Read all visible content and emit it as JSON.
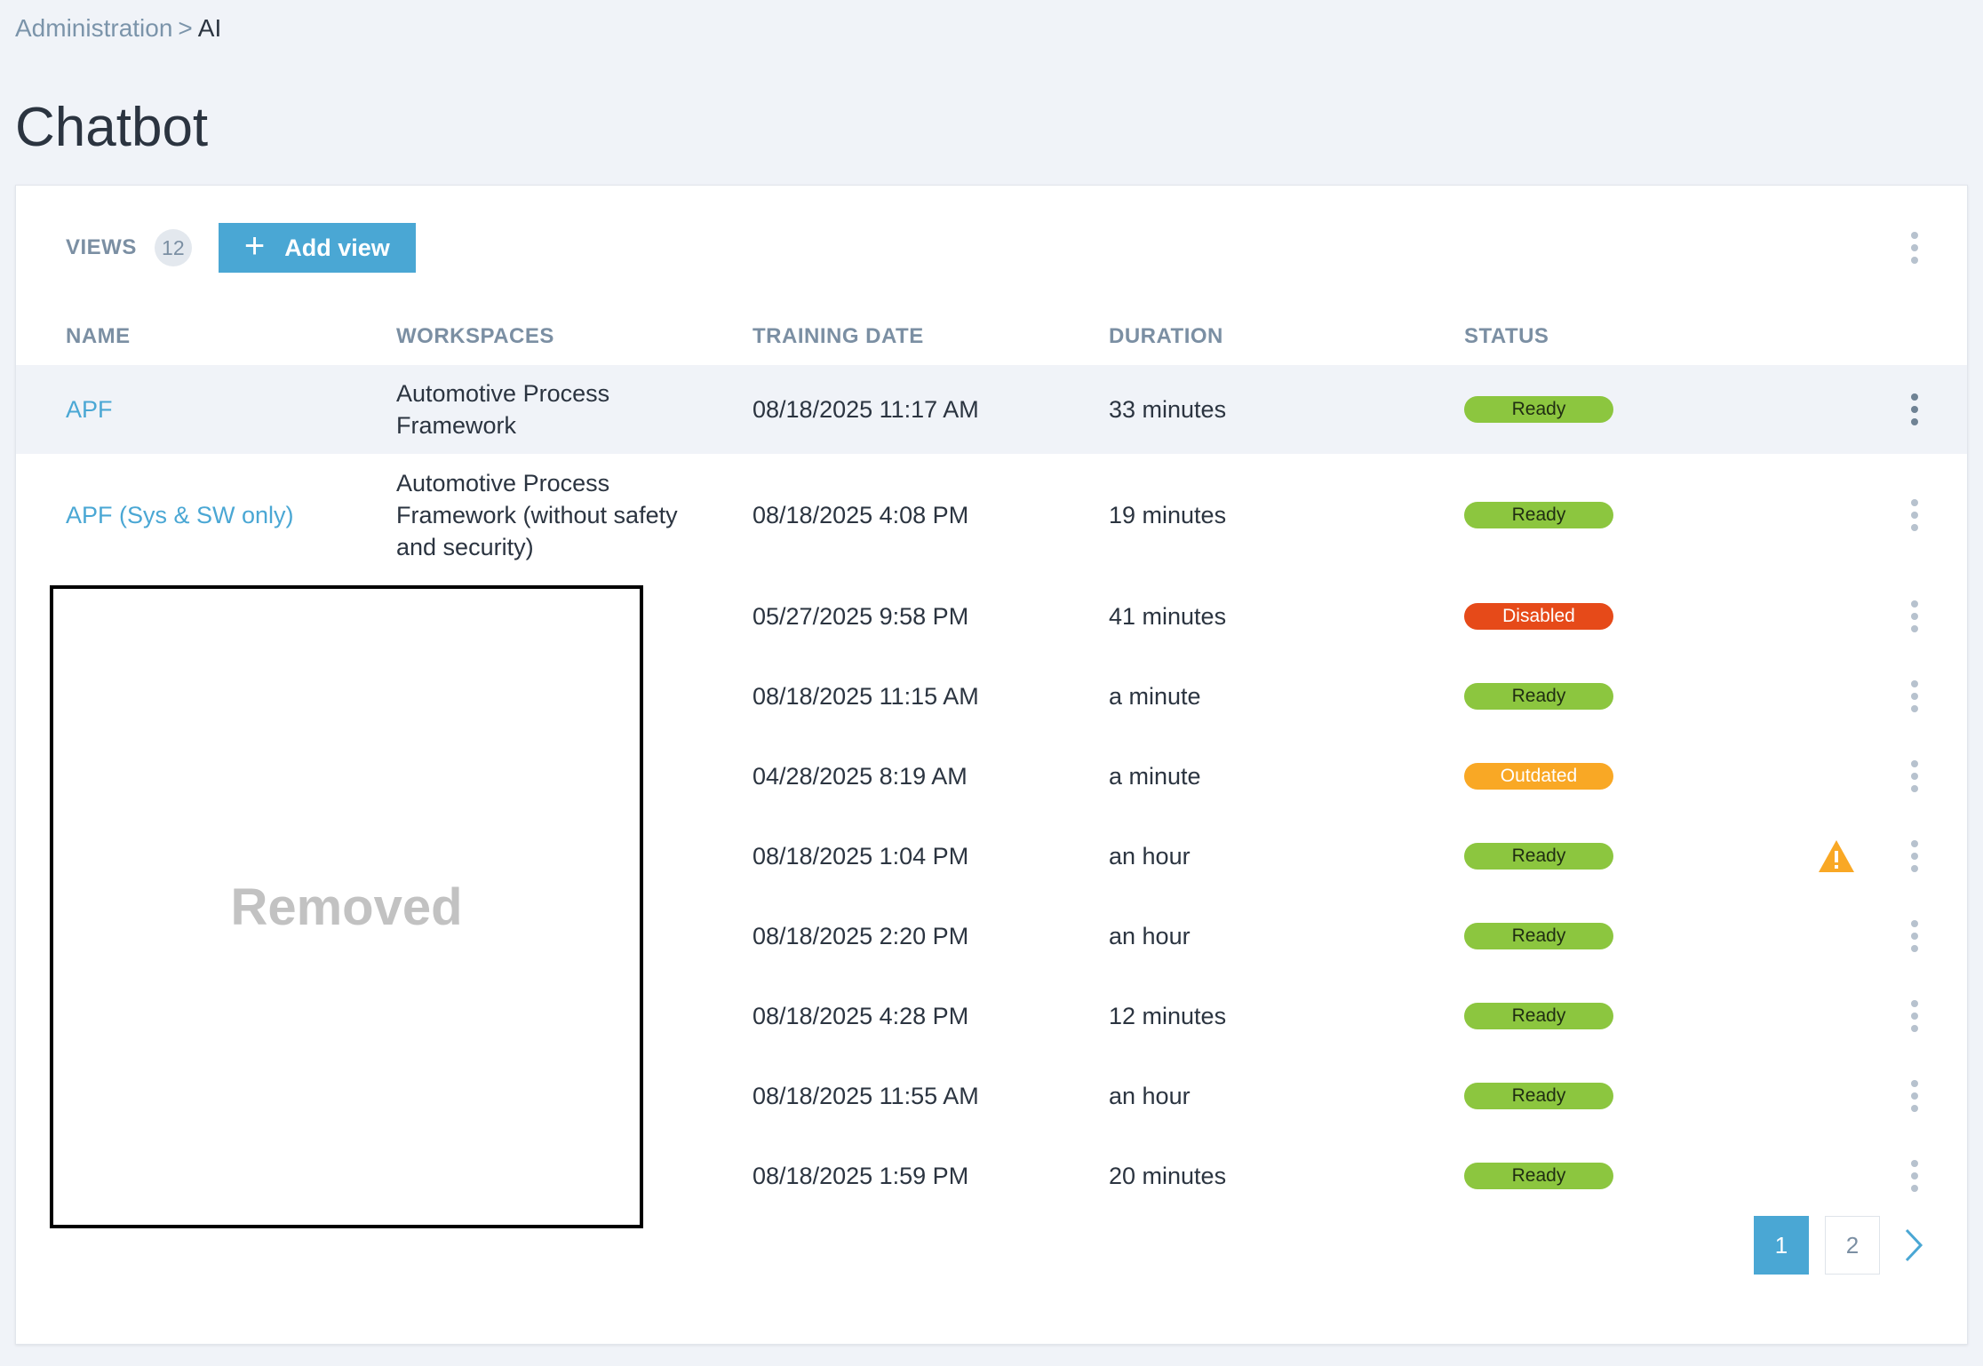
{
  "breadcrumb": {
    "parent": "Administration",
    "separator": ">",
    "current": "AI"
  },
  "page": {
    "title": "Chatbot"
  },
  "toolbar": {
    "views_label": "VIEWS",
    "views_count": "12",
    "add_view_label": "Add view",
    "add_icon": "plus-icon",
    "menu_icon": "vertical-dots-icon"
  },
  "columns": {
    "name": "NAME",
    "workspaces": "WORKSPACES",
    "training_date": "TRAINING DATE",
    "duration": "DURATION",
    "status": "STATUS"
  },
  "rows": [
    {
      "name": "APF",
      "workspaces": [
        "Automotive Process",
        "Framework"
      ],
      "training_date": "08/18/2025 11:17 AM",
      "duration": "33 minutes",
      "status": "Ready",
      "status_kind": "ready",
      "warning": false
    },
    {
      "name": "APF (Sys & SW only)",
      "workspaces": [
        "Automotive Process",
        "Framework (without safety",
        "and security)"
      ],
      "training_date": "08/18/2025 4:08 PM",
      "duration": "19 minutes",
      "status": "Ready",
      "status_kind": "ready",
      "warning": false
    },
    {
      "name": "",
      "workspaces": [],
      "training_date": "05/27/2025 9:58 PM",
      "duration": "41 minutes",
      "status": "Disabled",
      "status_kind": "disabled",
      "warning": false
    },
    {
      "name": "",
      "workspaces": [],
      "training_date": "08/18/2025 11:15 AM",
      "duration": "a minute",
      "status": "Ready",
      "status_kind": "ready",
      "warning": false
    },
    {
      "name": "",
      "workspaces": [],
      "training_date": "04/28/2025 8:19 AM",
      "duration": "a minute",
      "status": "Outdated",
      "status_kind": "outdated",
      "warning": false
    },
    {
      "name": "",
      "workspaces": [],
      "training_date": "08/18/2025 1:04 PM",
      "duration": "an hour",
      "status": "Ready",
      "status_kind": "ready",
      "warning": true
    },
    {
      "name": "",
      "workspaces": [],
      "training_date": "08/18/2025 2:20 PM",
      "duration": "an hour",
      "status": "Ready",
      "status_kind": "ready",
      "warning": false
    },
    {
      "name": "",
      "workspaces": [],
      "training_date": "08/18/2025 4:28 PM",
      "duration": "12 minutes",
      "status": "Ready",
      "status_kind": "ready",
      "warning": false
    },
    {
      "name": "",
      "workspaces": [],
      "training_date": "08/18/2025 11:55 AM",
      "duration": "an hour",
      "status": "Ready",
      "status_kind": "ready",
      "warning": false
    },
    {
      "name": "",
      "workspaces": [],
      "training_date": "08/18/2025 1:59 PM",
      "duration": "20 minutes",
      "status": "Ready",
      "status_kind": "ready",
      "warning": false
    }
  ],
  "redaction": {
    "label": "Removed"
  },
  "pagination": {
    "pages": [
      "1",
      "2"
    ],
    "current": "1",
    "next_icon": "chevron-right-icon"
  },
  "colors": {
    "accent": "#4aa7d4",
    "ready": "#8cc63f",
    "disabled": "#e64a19",
    "outdated": "#f9a825",
    "warning": "#f9a825"
  }
}
